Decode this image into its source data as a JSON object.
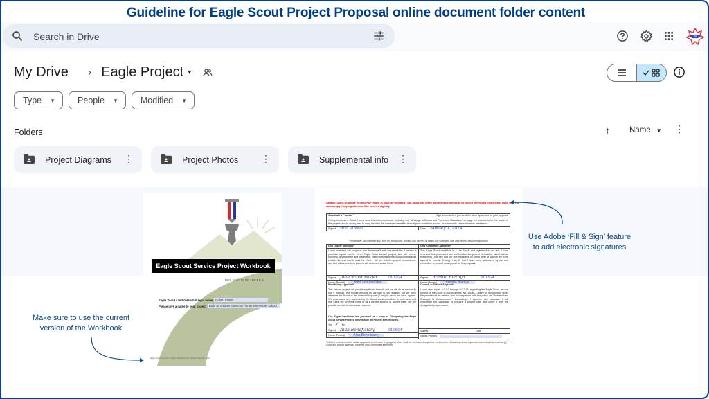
{
  "title": "Guideline for  Eagle Scout Project Proposal online document folder content",
  "topbar": {
    "search_placeholder": "Search in Drive",
    "icons": [
      "search-icon",
      "tune-icon",
      "help-icon",
      "settings-icon",
      "apps-icon",
      "bsa-logo-avatar"
    ]
  },
  "breadcrumb": {
    "root": "My Drive",
    "separator": "›",
    "current": "Eagle Project",
    "caret": "▾"
  },
  "filters": [
    {
      "label": "Type"
    },
    {
      "label": "People"
    },
    {
      "label": "Modified"
    }
  ],
  "view": {
    "selected": "grid",
    "options": [
      "list",
      "grid"
    ]
  },
  "folders_section": {
    "label": "Folders",
    "sort_field": "Name",
    "sort_direction": "ascending",
    "items": [
      {
        "name": "Project Diagrams"
      },
      {
        "name": "Project Photos"
      },
      {
        "name": "Supplemental info"
      }
    ]
  },
  "workbook": {
    "title": "Eagle Scout Service Project Workbook",
    "org": "BOY SCOUTS OF AMERICA",
    "fields": [
      {
        "label": "Eagle Scout candidate's full legal name",
        "value": "Robert Powell"
      },
      {
        "label": "Please give a name to your project",
        "value": "Build an outdoor classroom for an elementary school"
      }
    ],
    "footer": "Eagle Scout Service Project Workbook No. 2023a February 2024"
  },
  "form": {
    "caution": "Caution: Using an Adobe or other PDF reader to insert a \"signature\" can cause this entire document's contents to be locked preventing future edits; make sure you save a copy if any signatures will be inserted digitally.",
    "candidate_promise": {
      "header": "Candidate's Promise*",
      "note": "Sign below before you seek the other approvals for your proposal",
      "body": "On my honor as a Scout, I have read this entire workbook, including the \"Message to Scouts and Parents or Guardians\" on page 4. I promise to be the leader of this project, and to do my best to carry it out for the maximum benefit to the religious institution, school, or community I have chose as beneficiary.",
      "signed_label": "Signed",
      "signed": "Bob Powell",
      "date_label": "Date",
      "date": "January 1, 2024"
    },
    "reminder": "* Remember: Do not begin any work on your project, or raise any money, or obtain any materials, until your project has been approved",
    "unit_leader": {
      "header": "Unit Leader Approval*",
      "body": "I have reviewed this proposal and discussed it with the candidate. I believe it provides impact worthy of an Eagle Scout service project, and will involve planning, development and leadership. I am comfortable the Scout understands what to do, and how to lead the effort. I will see that the project is monitored, and that adults or others present will not overshadow them.",
      "signed": "John Scoutmaster",
      "date": "01/12/24",
      "name_label": "Name (Printed)",
      "name": "John Scoutmaster"
    },
    "unit_committee": {
      "header": "Unit Committee Approval*",
      "body": "This Eagle Scout candidate is a Life Scout, and registered in our unit. I have reviewed this proposal. I am comfortable the project is feasible, and I will do everything I can see that our unit measures up to the level of support we have agreed to provide (if any). I certify that I have been authorized by our unit committee to provide its approval for this proposal.",
      "signed": "Brenda Blethyn",
      "date": "01/13/24",
      "name_label": "Name (Printed)",
      "name": "Brenda Blethyn"
    },
    "beneficiary": {
      "header": "Beneficiary Approval*",
      "body": "This service project will provide significant benefit, and we will do all we can to see it through. We realize funding on our part is not required, but we have informed the Scout of the financial support (if any) to which we have agreed. We understand any fund raising the Scout conducts will be in our name and that funds left over will come to us if we are allowed to accept them. We will provide receipts to donors as required.",
      "copy_note": "Our Eagle Candidate has provided us a copy of \"Navigating the Eagle Scout Service Project, Information for Project Beneficiaries.\"",
      "yes_label": "Yes",
      "no_label": "No",
      "yes_checked": true,
      "signed": "Alan Beneficiary",
      "date": "01/05/24",
      "name_label": "Name (Printed)",
      "name": "Alan Beneficiary"
    },
    "council": {
      "header": "Council or District Approval",
      "body": "I have read topics 9.0.2.0 through 9.0.2.15, regarding the Eagle Scout service project, in the Guide to Advancement, No. 33088. I agree on my honor to apply the procedures as written, and in compliance with the policy on \"Unauthorized Changes to Advancement.\" Accordingly, I approve this proposal. I will encourage the candidate to prepare a project plan and share it with the designated project coach.",
      "signed_label": "Signed",
      "date_label": "Date",
      "name_label": "Name (Printed)"
    },
    "footnote": "* While it makes sense to obtain approvals in the order they appear, there shall be no required sequence for the order of obtaining those approvals marked with an asterisk (*). Council or district approval, however, must come after the others."
  },
  "annotations": {
    "workbook_note": [
      "Make sure to use the current",
      "version of the Workbook"
    ],
    "signature_note": [
      "Use Adobe ‘Fill & Sign’ feature",
      "to add electronic signatures"
    ]
  },
  "colors": {
    "title": "#003f87",
    "frame_border": "#0b3f8c",
    "annotation": "#0b4a8f",
    "view_active": "#c2e7ff",
    "folder_bg": "#f0f4f9",
    "caution": "#ee0000"
  }
}
